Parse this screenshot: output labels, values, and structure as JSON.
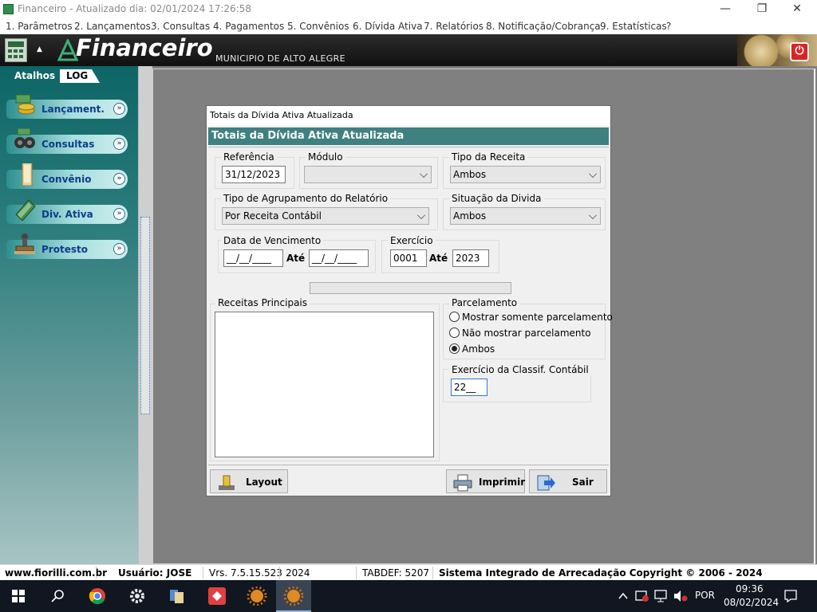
{
  "window": {
    "title": "Financeiro - Atualizado dia: 02/01/2024 17:26:58",
    "minimize": "—",
    "restore": "❐",
    "close": "✕"
  },
  "menu": [
    "1. Parâmetros",
    "2. Lançamentos",
    "3. Consultas",
    "4. Pagamentos",
    "5. Convênios",
    "6. Dívida Ativa",
    "7. Relatórios",
    "8. Notificação/Cobrança",
    "9. Estatísticas",
    "?"
  ],
  "header": {
    "brand": "Financeiro",
    "municipality": "MUNICIPIO DE ALTO ALEGRE",
    "calc_arrow": "▲",
    "power": "⏻"
  },
  "sidebar": {
    "tabs": [
      "Atalhos",
      "LOG"
    ],
    "items": [
      {
        "label": "Lançament.",
        "icon": "money-stack-icon"
      },
      {
        "label": "Consultas",
        "icon": "binoculars-icon"
      },
      {
        "label": "Convênio",
        "icon": "folder-icon"
      },
      {
        "label": "Div. Ativa",
        "icon": "book-icon"
      },
      {
        "label": "Protesto",
        "icon": "stamp-icon"
      }
    ],
    "chevron": "»"
  },
  "dialog": {
    "caption": "Totais da Dívida Ativa Atualizada",
    "header": "Totais da Dívida Ativa Atualizada",
    "referencia": {
      "label": "Referência",
      "value": "31/12/2023"
    },
    "modulo": {
      "label": "Módulo",
      "value": ""
    },
    "tipo_receita": {
      "label": "Tipo da Receita",
      "value": "Ambos"
    },
    "agrupamento": {
      "label": "Tipo de Agrupamento do Relatório",
      "value": "Por Receita Contábil"
    },
    "situacao": {
      "label": "Situação da Divida",
      "value": "Ambos"
    },
    "vencimento": {
      "label": "Data de Vencimento",
      "from": "__/__/____",
      "to": "__/__/____",
      "ate": "Até"
    },
    "exercicio": {
      "label": "Exercício",
      "from": "0001",
      "to": "2023",
      "ate": "Até"
    },
    "receitas": {
      "label": "Receitas Principais"
    },
    "parcelamento": {
      "label": "Parcelamento",
      "options": [
        "Mostrar somente parcelamento",
        "Não mostrar parcelamento",
        "Ambos"
      ],
      "selected": 2
    },
    "classif": {
      "label": "Exercício da Classif. Contábil",
      "value": "22__"
    },
    "buttons": {
      "layout": "Layout",
      "print": "Imprimir",
      "exit": "Sair"
    }
  },
  "status": {
    "site": "www.fiorilli.com.br",
    "user": "Usuário: JOSE",
    "version": "Vrs. 7.5.15.523",
    "year": "2024",
    "tabdef": "TABDEF: 5207",
    "copyright": "Sistema Integrado de Arrecadação Copyright © 2006 - 2024"
  },
  "taskbar": {
    "lang": "POR",
    "time": "09:36",
    "date": "08/02/2024"
  }
}
